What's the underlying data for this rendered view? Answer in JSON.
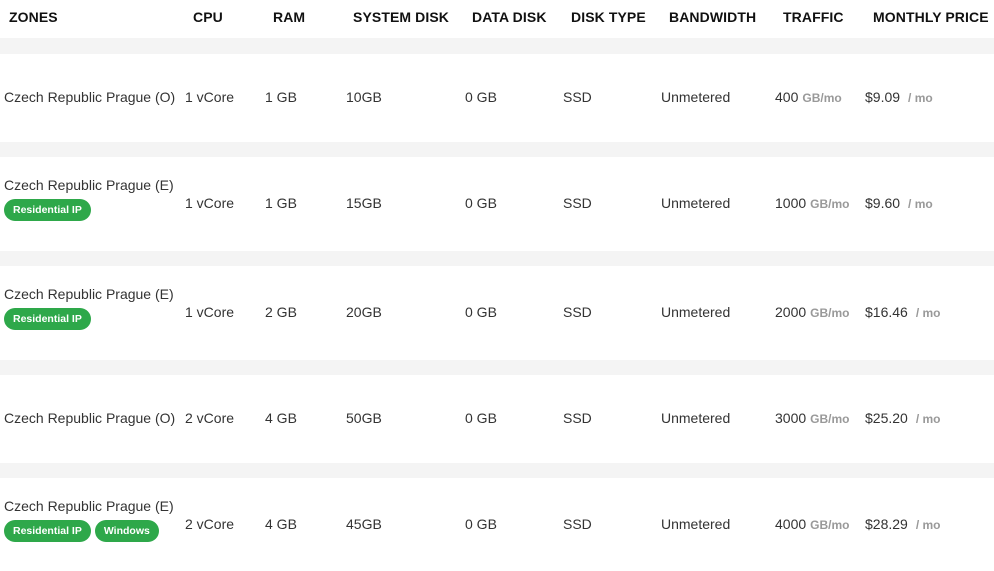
{
  "headers": {
    "zones": "ZONES",
    "cpu": "CPU",
    "ram": "RAM",
    "system_disk": "SYSTEM DISK",
    "data_disk": "DATA DISK",
    "disk_type": "DISK TYPE",
    "bandwidth": "BANDWIDTH",
    "traffic": "TRAFFIC",
    "monthly_price": "MONTHLY PRICE"
  },
  "traffic_unit": "GB/mo",
  "price_unit": "/ mo",
  "colors": {
    "badge": "#2ea84a",
    "row_bg": "#ffffff",
    "gap_bg": "#f4f4f4"
  },
  "rows": [
    {
      "zone": "Czech Republic Prague (O)",
      "badges": [],
      "cpu": "1 vCore",
      "ram": "1 GB",
      "system_disk": "10GB",
      "data_disk": "0 GB",
      "disk_type": "SSD",
      "bandwidth": "Unmetered",
      "traffic": "400",
      "price": "$9.09"
    },
    {
      "zone": "Czech Republic Prague (E)",
      "badges": [
        "Residential IP"
      ],
      "cpu": "1 vCore",
      "ram": "1 GB",
      "system_disk": "15GB",
      "data_disk": "0 GB",
      "disk_type": "SSD",
      "bandwidth": "Unmetered",
      "traffic": "1000",
      "price": "$9.60"
    },
    {
      "zone": "Czech Republic Prague (E)",
      "badges": [
        "Residential IP"
      ],
      "cpu": "1 vCore",
      "ram": "2 GB",
      "system_disk": "20GB",
      "data_disk": "0 GB",
      "disk_type": "SSD",
      "bandwidth": "Unmetered",
      "traffic": "2000",
      "price": "$16.46"
    },
    {
      "zone": "Czech Republic Prague (O)",
      "badges": [],
      "cpu": "2 vCore",
      "ram": "4 GB",
      "system_disk": "50GB",
      "data_disk": "0 GB",
      "disk_type": "SSD",
      "bandwidth": "Unmetered",
      "traffic": "3000",
      "price": "$25.20"
    },
    {
      "zone": "Czech Republic Prague (E)",
      "badges": [
        "Residential IP",
        "Windows"
      ],
      "cpu": "2 vCore",
      "ram": "4 GB",
      "system_disk": "45GB",
      "data_disk": "0 GB",
      "disk_type": "SSD",
      "bandwidth": "Unmetered",
      "traffic": "4000",
      "price": "$28.29"
    }
  ]
}
